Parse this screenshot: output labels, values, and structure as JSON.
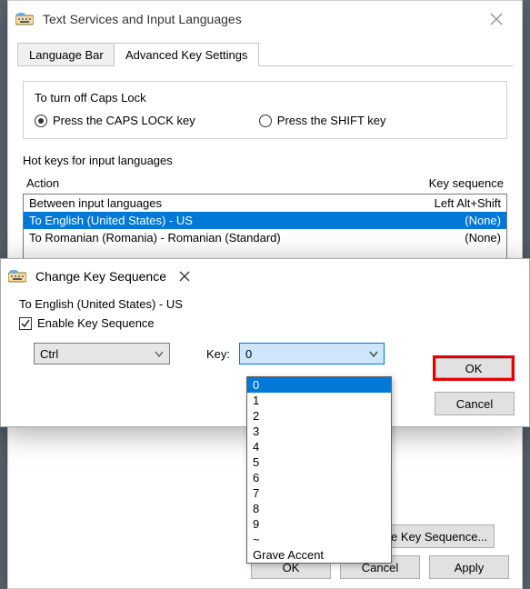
{
  "parent": {
    "title": "Text Services and Input Languages",
    "tabs": {
      "language_bar": "Language Bar",
      "advanced": "Advanced Key Settings"
    },
    "caps": {
      "heading": "To turn off Caps Lock",
      "opt1": "Press the CAPS LOCK key",
      "opt2": "Press the SHIFT key"
    },
    "hotkeys": {
      "heading": "Hot keys for input languages",
      "col_action": "Action",
      "col_seq": "Key sequence",
      "rows": [
        {
          "action": "Between input languages",
          "seq": "Left Alt+Shift"
        },
        {
          "action": "To English (United States) - US",
          "seq": "(None)"
        },
        {
          "action": "To Romanian (Romania) - Romanian (Standard)",
          "seq": "(None)"
        }
      ]
    },
    "change_btn": "Change Key Sequence...",
    "ok": "OK",
    "cancel": "Cancel",
    "apply": "Apply"
  },
  "child": {
    "title": "Change Key Sequence",
    "target": "To English (United States) - US",
    "enable": "Enable Key Sequence",
    "enable_checked": true,
    "modifier": "Ctrl",
    "key_label": "Key:",
    "key_selected": "0",
    "ok": "OK",
    "cancel": "Cancel",
    "options": [
      "0",
      "1",
      "2",
      "3",
      "4",
      "5",
      "6",
      "7",
      "8",
      "9",
      "~",
      "Grave Accent"
    ]
  }
}
